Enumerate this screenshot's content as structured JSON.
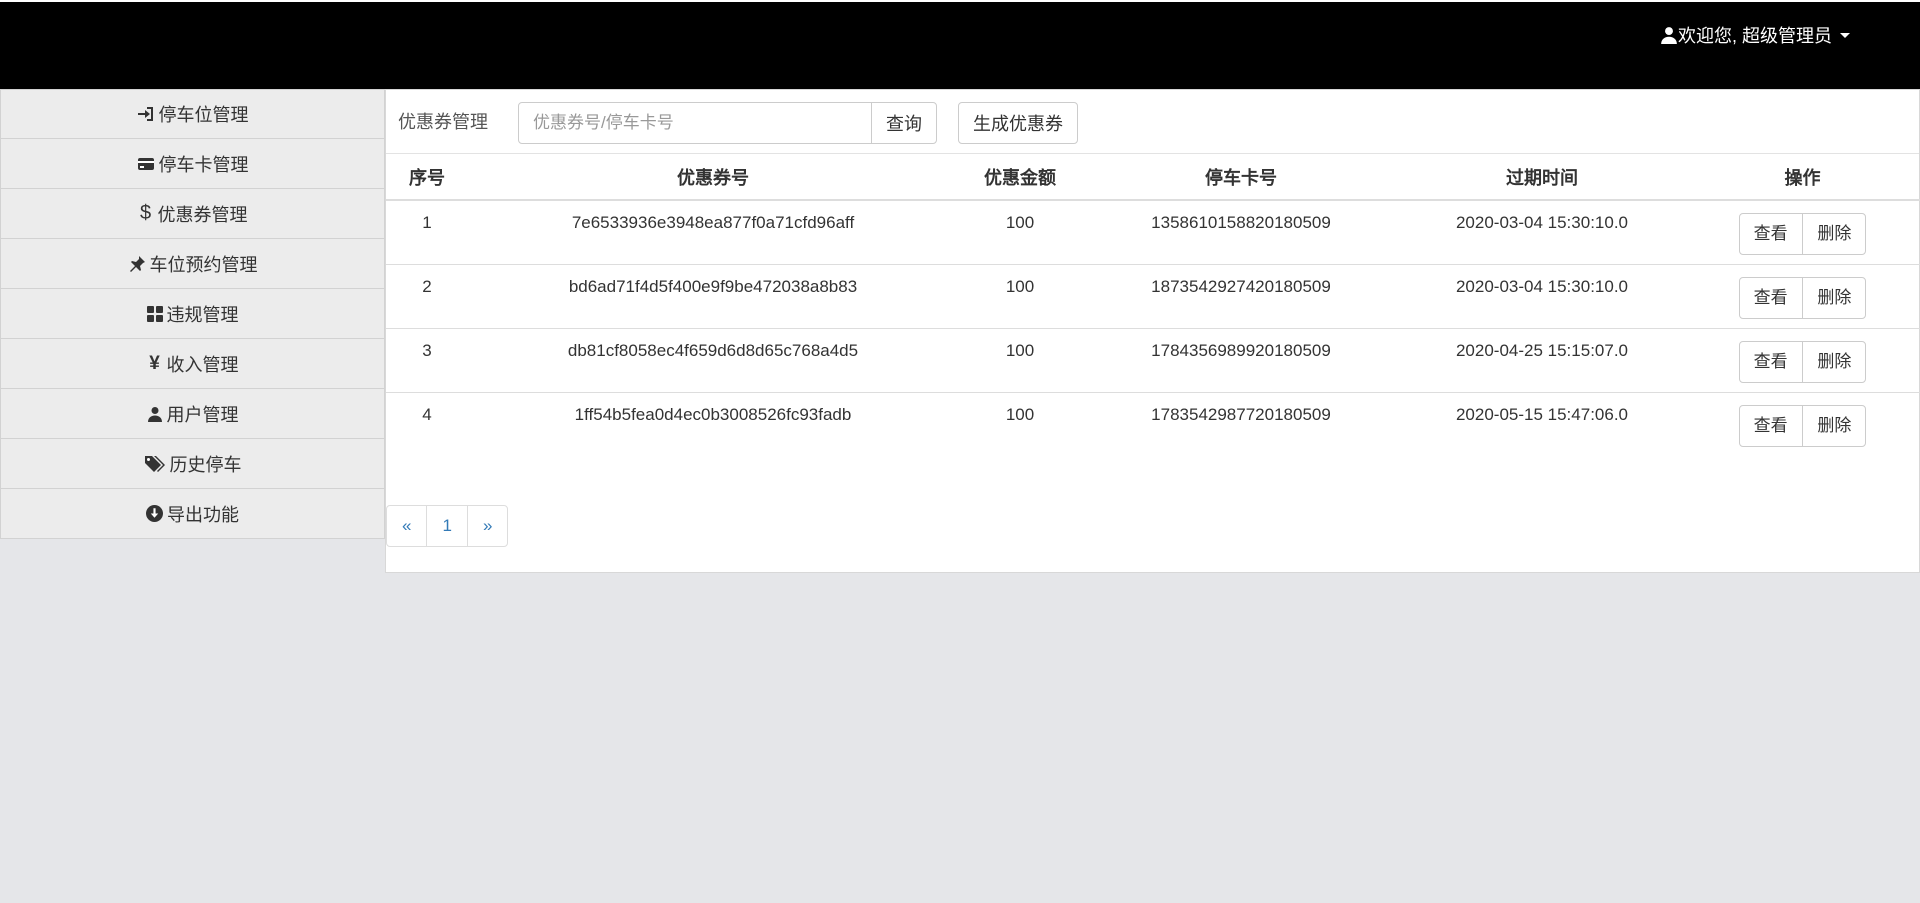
{
  "header": {
    "user_label": "欢迎您, 超级管理员"
  },
  "sidebar": {
    "items": [
      {
        "label": "停车位管理",
        "icon": "sign-in-icon"
      },
      {
        "label": "停车卡管理",
        "icon": "credit-card-icon"
      },
      {
        "label": "优惠券管理",
        "icon": "dollar-icon"
      },
      {
        "label": "车位预约管理",
        "icon": "pushpin-icon"
      },
      {
        "label": "违规管理",
        "icon": "th-large-icon"
      },
      {
        "label": "收入管理",
        "icon": "yen-icon"
      },
      {
        "label": "用户管理",
        "icon": "user-icon"
      },
      {
        "label": "历史停车",
        "icon": "tags-icon"
      },
      {
        "label": "导出功能",
        "icon": "download-icon"
      }
    ]
  },
  "toolbar": {
    "title": "优惠券管理",
    "search_placeholder": "优惠券号/停车卡号",
    "query_label": "查询",
    "generate_label": "生成优惠券"
  },
  "table": {
    "headers": [
      "序号",
      "优惠券号",
      "优惠金额",
      "停车卡号",
      "过期时间",
      "操作"
    ],
    "rows": [
      {
        "seq": "1",
        "code": "7e6533936e3948ea877f0a71cfd96aff",
        "amount": "100",
        "card": "1358610158820180509",
        "expire": "2020-03-04 15:30:10.0",
        "view": "查看",
        "del": "删除"
      },
      {
        "seq": "2",
        "code": "bd6ad71f4d5f400e9f9be472038a8b83",
        "amount": "100",
        "card": "1873542927420180509",
        "expire": "2020-03-04 15:30:10.0",
        "view": "查看",
        "del": "删除"
      },
      {
        "seq": "3",
        "code": "db81cf8058ec4f659d6d8d65c768a4d5",
        "amount": "100",
        "card": "1784356989920180509",
        "expire": "2020-04-25 15:15:07.0",
        "view": "查看",
        "del": "删除"
      },
      {
        "seq": "4",
        "code": "1ff54b5fea0d4ec0b3008526fc93fadb",
        "amount": "100",
        "card": "1783542987720180509",
        "expire": "2020-05-15 15:47:06.0",
        "view": "查看",
        "del": "删除"
      }
    ]
  },
  "pagination": {
    "prev": "«",
    "current": "1",
    "next": "»"
  },
  "colors": {
    "topbar": "#000000",
    "link": "#337ab7"
  }
}
